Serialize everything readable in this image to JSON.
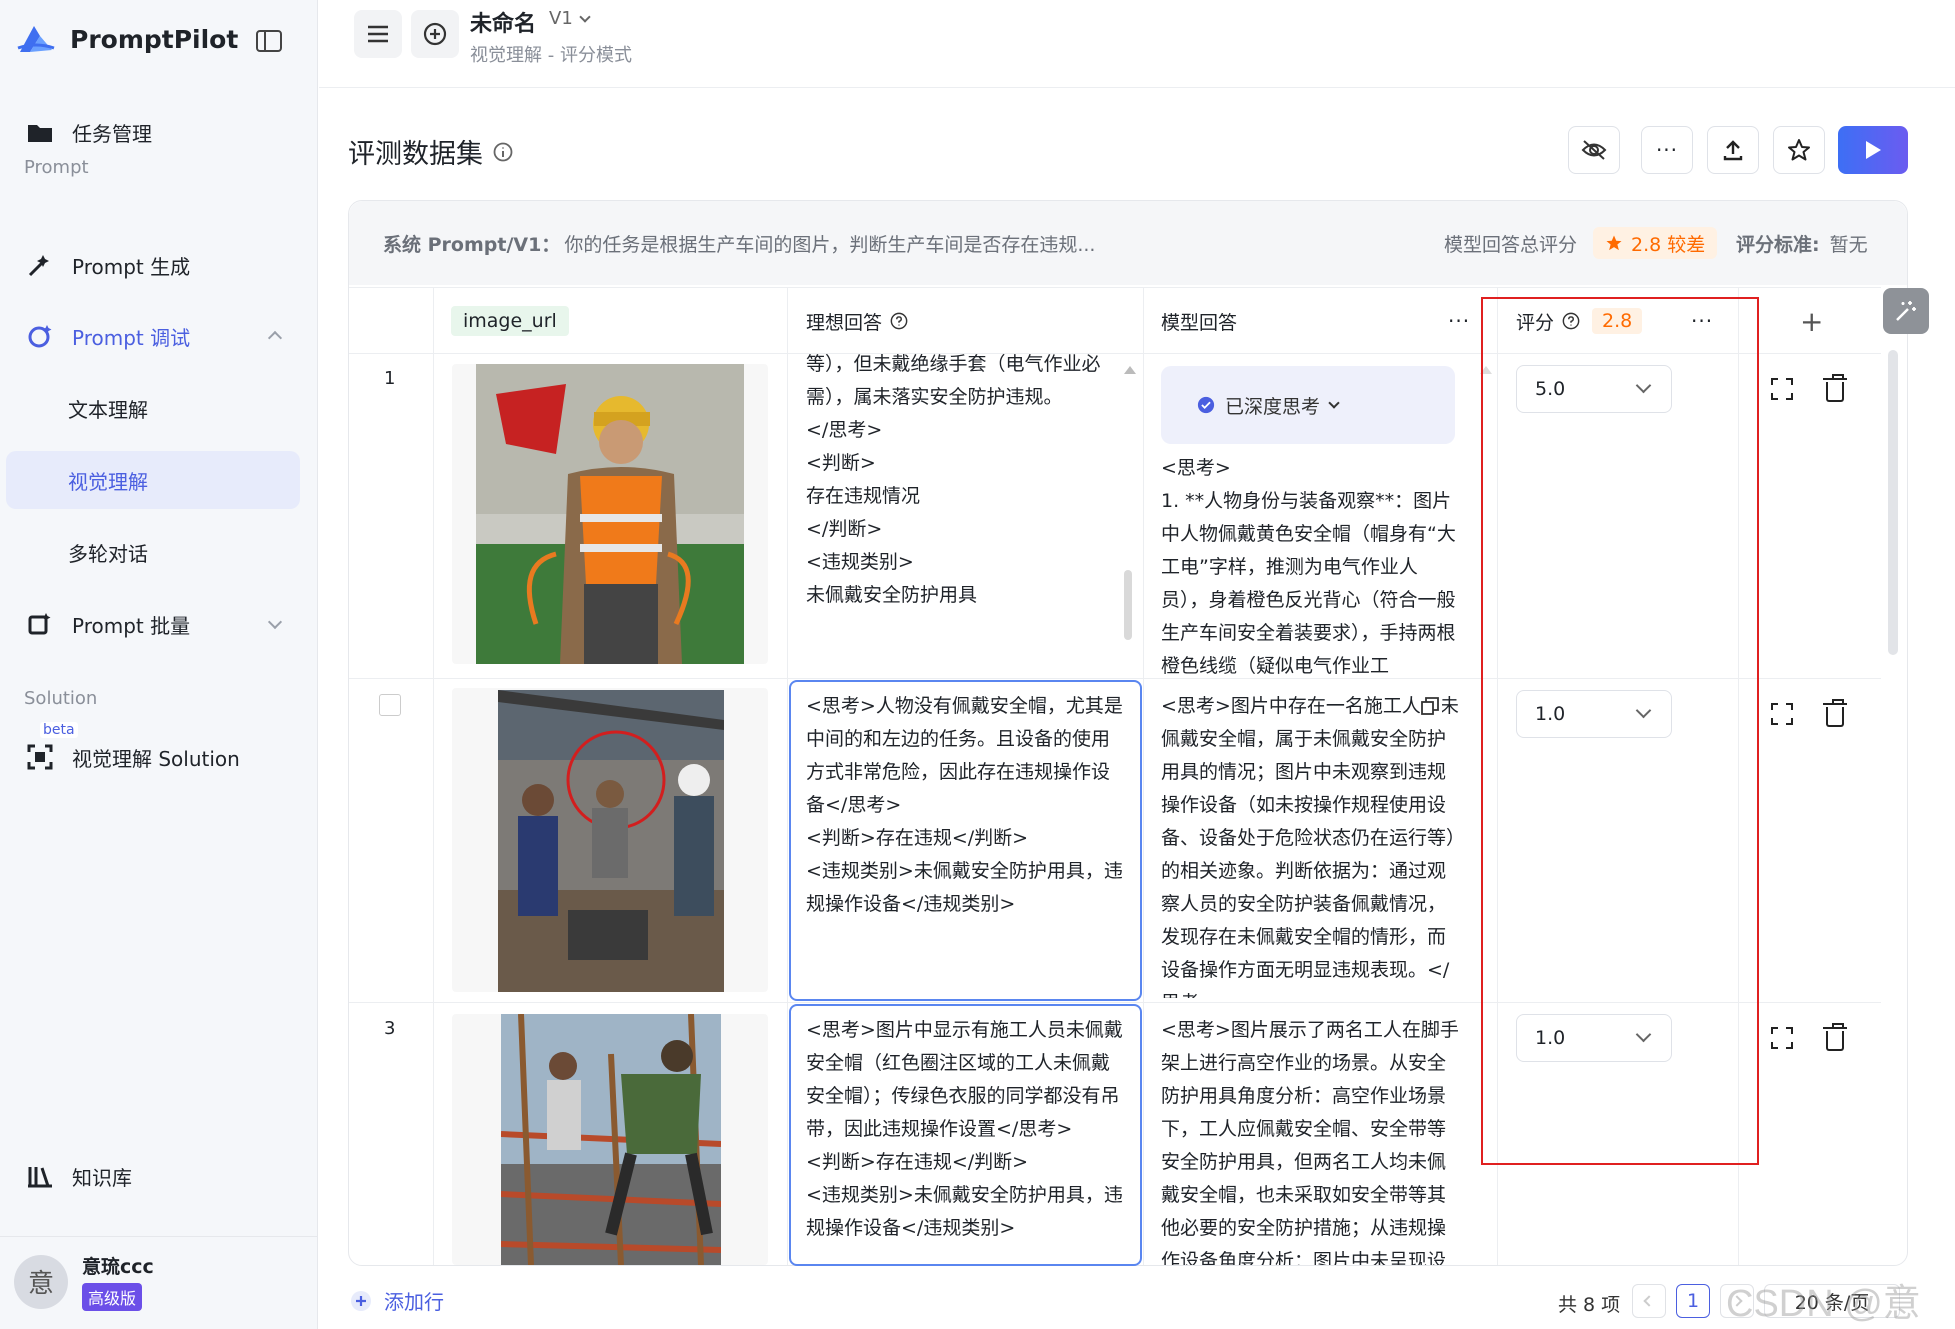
{
  "sidebar": {
    "brand": "PromptPilot",
    "task": "任务管理",
    "section_prompt": "Prompt",
    "prompt_gen": "Prompt 生成",
    "prompt_debug": "Prompt 调试",
    "text_understanding": "文本理解",
    "visual_understanding": "视觉理解",
    "multi_turn": "多轮对话",
    "prompt_batch": "Prompt 批量",
    "section_solution": "Solution",
    "beta": "beta",
    "visual_solution": "视觉理解 Solution",
    "knowledge": "知识库",
    "user_name": "意琉ccc",
    "avatar_char": "意",
    "plan": "高级版"
  },
  "header": {
    "title": "未命名",
    "version": "V1",
    "subtitle": "视觉理解 - 评分模式"
  },
  "page": {
    "title": "评测数据集"
  },
  "system": {
    "label": "系统 Prompt/V1：",
    "text": "你的任务是根据生产车间的图片，判断生产车间是否存在违规...",
    "total_label": "模型回答总评分",
    "total_score": "2.8 较差",
    "standard_label": "评分标准:",
    "standard_value": "暂无"
  },
  "columns": {
    "image": "image_url",
    "ideal": "理想回答",
    "model": "模型回答",
    "score": "评分",
    "score_avg": "2.8",
    "more": "···",
    "add": "+"
  },
  "rows": [
    {
      "index": "1",
      "ideal": "等），但未戴绝缘手套（电气作业必需），属未落实安全防护违规。\n</思考>\n<判断>\n存在违规情况\n</判断>\n<违规类别>\n未佩戴安全防护用具",
      "deep_think": "已深度思考",
      "model": "<思考>\n1. **人物身份与装备观察**：图片中人物佩戴黄色安全帽（帽身有“大工电”字样，推测为电气作业人员），身着橙色反光背心（符合一般生产车间安全着装要求），手持两根橙色线缆（疑似电气作业工",
      "score": "5.0"
    },
    {
      "index": "",
      "ideal": "<思考>人物没有佩戴安全帽，尤其是中间的和左边的任务。且设备的使用方式非常危险，因此存在违规操作设备</思考>\n<判断>存在违规</判断>\n<违规类别>未佩戴安全防护用具，违规操作设备</违规类别>",
      "model": "<思考>图片中存在一名施工人员未佩戴安全帽，属于未佩戴安全防护用具的情况；图片中未观察到违规操作设备（如未按操作规程使用设备、设备处于危险状态仍在运行等）的相关迹象。判断依据为：通过观察人员的安全防护装备佩戴情况，发现存在未佩戴安全帽的情形，而设备操作方面无明显违规表现。</思考>",
      "score": "1.0"
    },
    {
      "index": "3",
      "ideal": "<思考>图片中显示有施工人员未佩戴安全帽（红色圈注区域的工人未佩戴安全帽）；传绿色衣服的同学都没有吊带，因此违规操作设置</思考>\n<判断>存在违规</判断>\n<违规类别>未佩戴安全防护用具，违规操作设备</违规类别>",
      "model": "<思考>图片展示了两名工人在脚手架上进行高空作业的场景。从安全防护用具角度分析：高空作业场景下，工人应佩戴安全帽、安全带等安全防护用具，但两名工人均未佩戴安全帽，也未采取如安全带等其他必要的安全防护措施；从违规操作设备角度分析：图片中未呈现设",
      "score": "1.0"
    }
  ],
  "footer": {
    "add_row": "添加行",
    "total": "共 8 项",
    "page": "1",
    "page_size": "20 条/页"
  },
  "watermark": "CSDN @意琉",
  "colors": {
    "accent": "#4b5fe0",
    "warning": "#ff7a00",
    "highlight": "#e02020"
  }
}
